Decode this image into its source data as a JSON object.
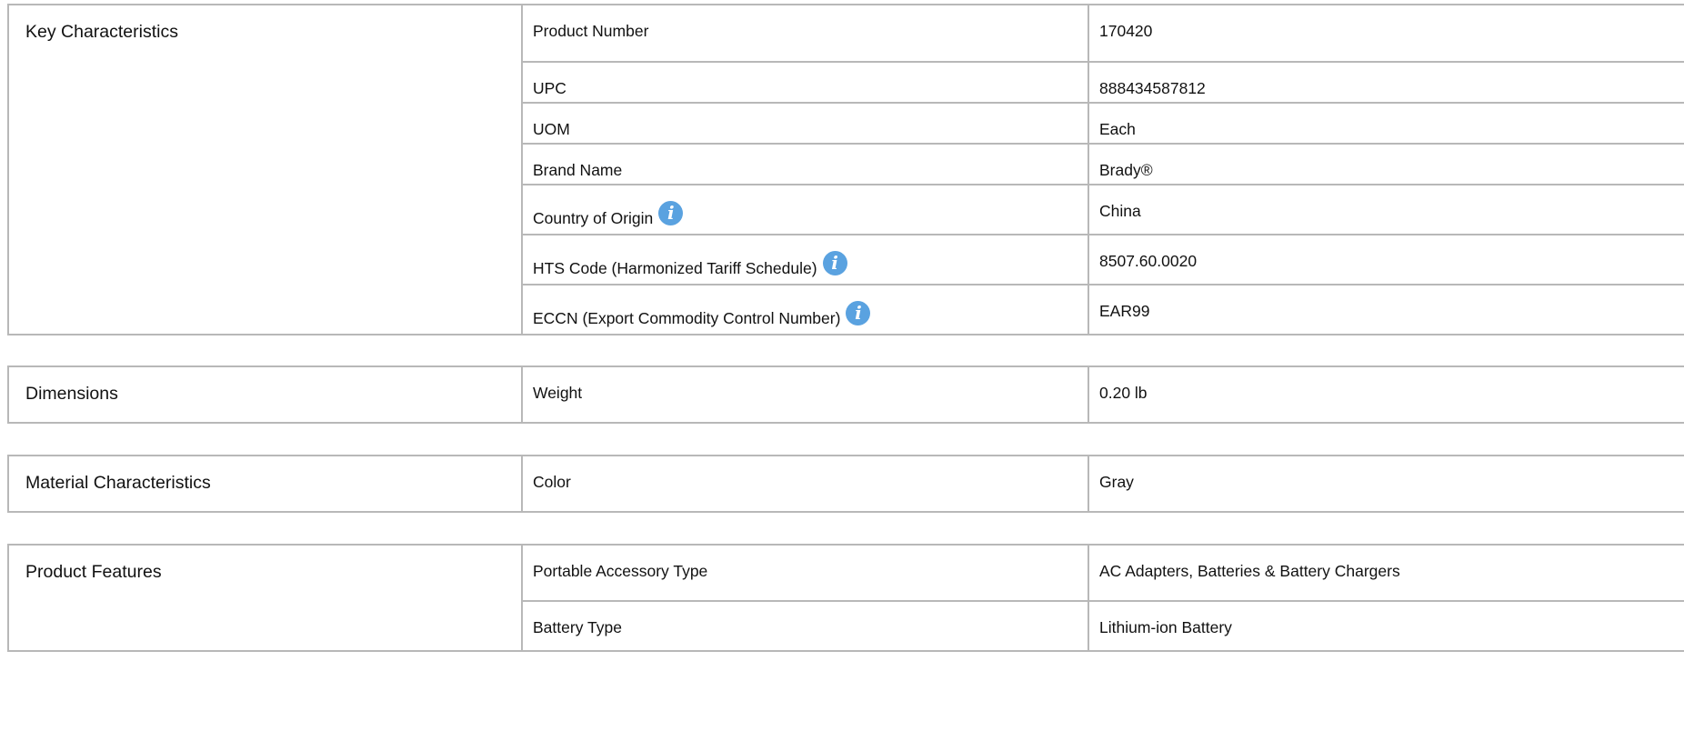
{
  "sections": {
    "key": {
      "title": "Key Characteristics",
      "rows": [
        {
          "label": "Product Number",
          "value": "170420"
        },
        {
          "label": "UPC",
          "value": "888434587812"
        },
        {
          "label": "UOM",
          "value": "Each"
        },
        {
          "label": "Brand Name",
          "value": "Brady®"
        },
        {
          "label": "Country of Origin",
          "value": "China",
          "icon": "info-icon"
        },
        {
          "label": "HTS Code (Harmonized Tariff Schedule)",
          "value": "8507.60.0020",
          "icon": "info-icon"
        },
        {
          "label": "ECCN (Export Commodity Control Number)",
          "value": "EAR99",
          "icon": "info-icon"
        }
      ]
    },
    "dimensions": {
      "title": "Dimensions",
      "rows": [
        {
          "label": "Weight",
          "value": "0.20 lb"
        }
      ]
    },
    "material": {
      "title": "Material Characteristics",
      "rows": [
        {
          "label": "Color",
          "value": "Gray"
        }
      ]
    },
    "features": {
      "title": "Product Features",
      "rows": [
        {
          "label": "Portable Accessory Type",
          "value": "AC Adapters, Batteries & Battery Chargers"
        },
        {
          "label": "Battery Type",
          "value": "Lithium-ion Battery"
        }
      ]
    }
  },
  "icon_glyph": "i",
  "colors": {
    "info_icon": "#5aa2e0",
    "border": "#b8b8b8"
  }
}
